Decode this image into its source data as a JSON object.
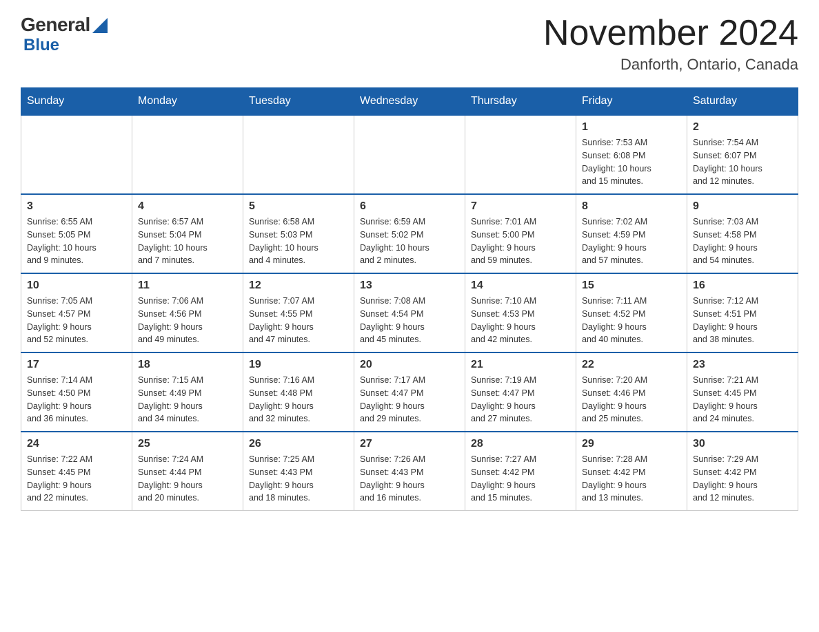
{
  "header": {
    "logo_general": "General",
    "logo_blue": "Blue",
    "month_title": "November 2024",
    "location": "Danforth, Ontario, Canada"
  },
  "weekdays": [
    "Sunday",
    "Monday",
    "Tuesday",
    "Wednesday",
    "Thursday",
    "Friday",
    "Saturday"
  ],
  "weeks": [
    [
      {
        "day": "",
        "info": ""
      },
      {
        "day": "",
        "info": ""
      },
      {
        "day": "",
        "info": ""
      },
      {
        "day": "",
        "info": ""
      },
      {
        "day": "",
        "info": ""
      },
      {
        "day": "1",
        "info": "Sunrise: 7:53 AM\nSunset: 6:08 PM\nDaylight: 10 hours\nand 15 minutes."
      },
      {
        "day": "2",
        "info": "Sunrise: 7:54 AM\nSunset: 6:07 PM\nDaylight: 10 hours\nand 12 minutes."
      }
    ],
    [
      {
        "day": "3",
        "info": "Sunrise: 6:55 AM\nSunset: 5:05 PM\nDaylight: 10 hours\nand 9 minutes."
      },
      {
        "day": "4",
        "info": "Sunrise: 6:57 AM\nSunset: 5:04 PM\nDaylight: 10 hours\nand 7 minutes."
      },
      {
        "day": "5",
        "info": "Sunrise: 6:58 AM\nSunset: 5:03 PM\nDaylight: 10 hours\nand 4 minutes."
      },
      {
        "day": "6",
        "info": "Sunrise: 6:59 AM\nSunset: 5:02 PM\nDaylight: 10 hours\nand 2 minutes."
      },
      {
        "day": "7",
        "info": "Sunrise: 7:01 AM\nSunset: 5:00 PM\nDaylight: 9 hours\nand 59 minutes."
      },
      {
        "day": "8",
        "info": "Sunrise: 7:02 AM\nSunset: 4:59 PM\nDaylight: 9 hours\nand 57 minutes."
      },
      {
        "day": "9",
        "info": "Sunrise: 7:03 AM\nSunset: 4:58 PM\nDaylight: 9 hours\nand 54 minutes."
      }
    ],
    [
      {
        "day": "10",
        "info": "Sunrise: 7:05 AM\nSunset: 4:57 PM\nDaylight: 9 hours\nand 52 minutes."
      },
      {
        "day": "11",
        "info": "Sunrise: 7:06 AM\nSunset: 4:56 PM\nDaylight: 9 hours\nand 49 minutes."
      },
      {
        "day": "12",
        "info": "Sunrise: 7:07 AM\nSunset: 4:55 PM\nDaylight: 9 hours\nand 47 minutes."
      },
      {
        "day": "13",
        "info": "Sunrise: 7:08 AM\nSunset: 4:54 PM\nDaylight: 9 hours\nand 45 minutes."
      },
      {
        "day": "14",
        "info": "Sunrise: 7:10 AM\nSunset: 4:53 PM\nDaylight: 9 hours\nand 42 minutes."
      },
      {
        "day": "15",
        "info": "Sunrise: 7:11 AM\nSunset: 4:52 PM\nDaylight: 9 hours\nand 40 minutes."
      },
      {
        "day": "16",
        "info": "Sunrise: 7:12 AM\nSunset: 4:51 PM\nDaylight: 9 hours\nand 38 minutes."
      }
    ],
    [
      {
        "day": "17",
        "info": "Sunrise: 7:14 AM\nSunset: 4:50 PM\nDaylight: 9 hours\nand 36 minutes."
      },
      {
        "day": "18",
        "info": "Sunrise: 7:15 AM\nSunset: 4:49 PM\nDaylight: 9 hours\nand 34 minutes."
      },
      {
        "day": "19",
        "info": "Sunrise: 7:16 AM\nSunset: 4:48 PM\nDaylight: 9 hours\nand 32 minutes."
      },
      {
        "day": "20",
        "info": "Sunrise: 7:17 AM\nSunset: 4:47 PM\nDaylight: 9 hours\nand 29 minutes."
      },
      {
        "day": "21",
        "info": "Sunrise: 7:19 AM\nSunset: 4:47 PM\nDaylight: 9 hours\nand 27 minutes."
      },
      {
        "day": "22",
        "info": "Sunrise: 7:20 AM\nSunset: 4:46 PM\nDaylight: 9 hours\nand 25 minutes."
      },
      {
        "day": "23",
        "info": "Sunrise: 7:21 AM\nSunset: 4:45 PM\nDaylight: 9 hours\nand 24 minutes."
      }
    ],
    [
      {
        "day": "24",
        "info": "Sunrise: 7:22 AM\nSunset: 4:45 PM\nDaylight: 9 hours\nand 22 minutes."
      },
      {
        "day": "25",
        "info": "Sunrise: 7:24 AM\nSunset: 4:44 PM\nDaylight: 9 hours\nand 20 minutes."
      },
      {
        "day": "26",
        "info": "Sunrise: 7:25 AM\nSunset: 4:43 PM\nDaylight: 9 hours\nand 18 minutes."
      },
      {
        "day": "27",
        "info": "Sunrise: 7:26 AM\nSunset: 4:43 PM\nDaylight: 9 hours\nand 16 minutes."
      },
      {
        "day": "28",
        "info": "Sunrise: 7:27 AM\nSunset: 4:42 PM\nDaylight: 9 hours\nand 15 minutes."
      },
      {
        "day": "29",
        "info": "Sunrise: 7:28 AM\nSunset: 4:42 PM\nDaylight: 9 hours\nand 13 minutes."
      },
      {
        "day": "30",
        "info": "Sunrise: 7:29 AM\nSunset: 4:42 PM\nDaylight: 9 hours\nand 12 minutes."
      }
    ]
  ]
}
